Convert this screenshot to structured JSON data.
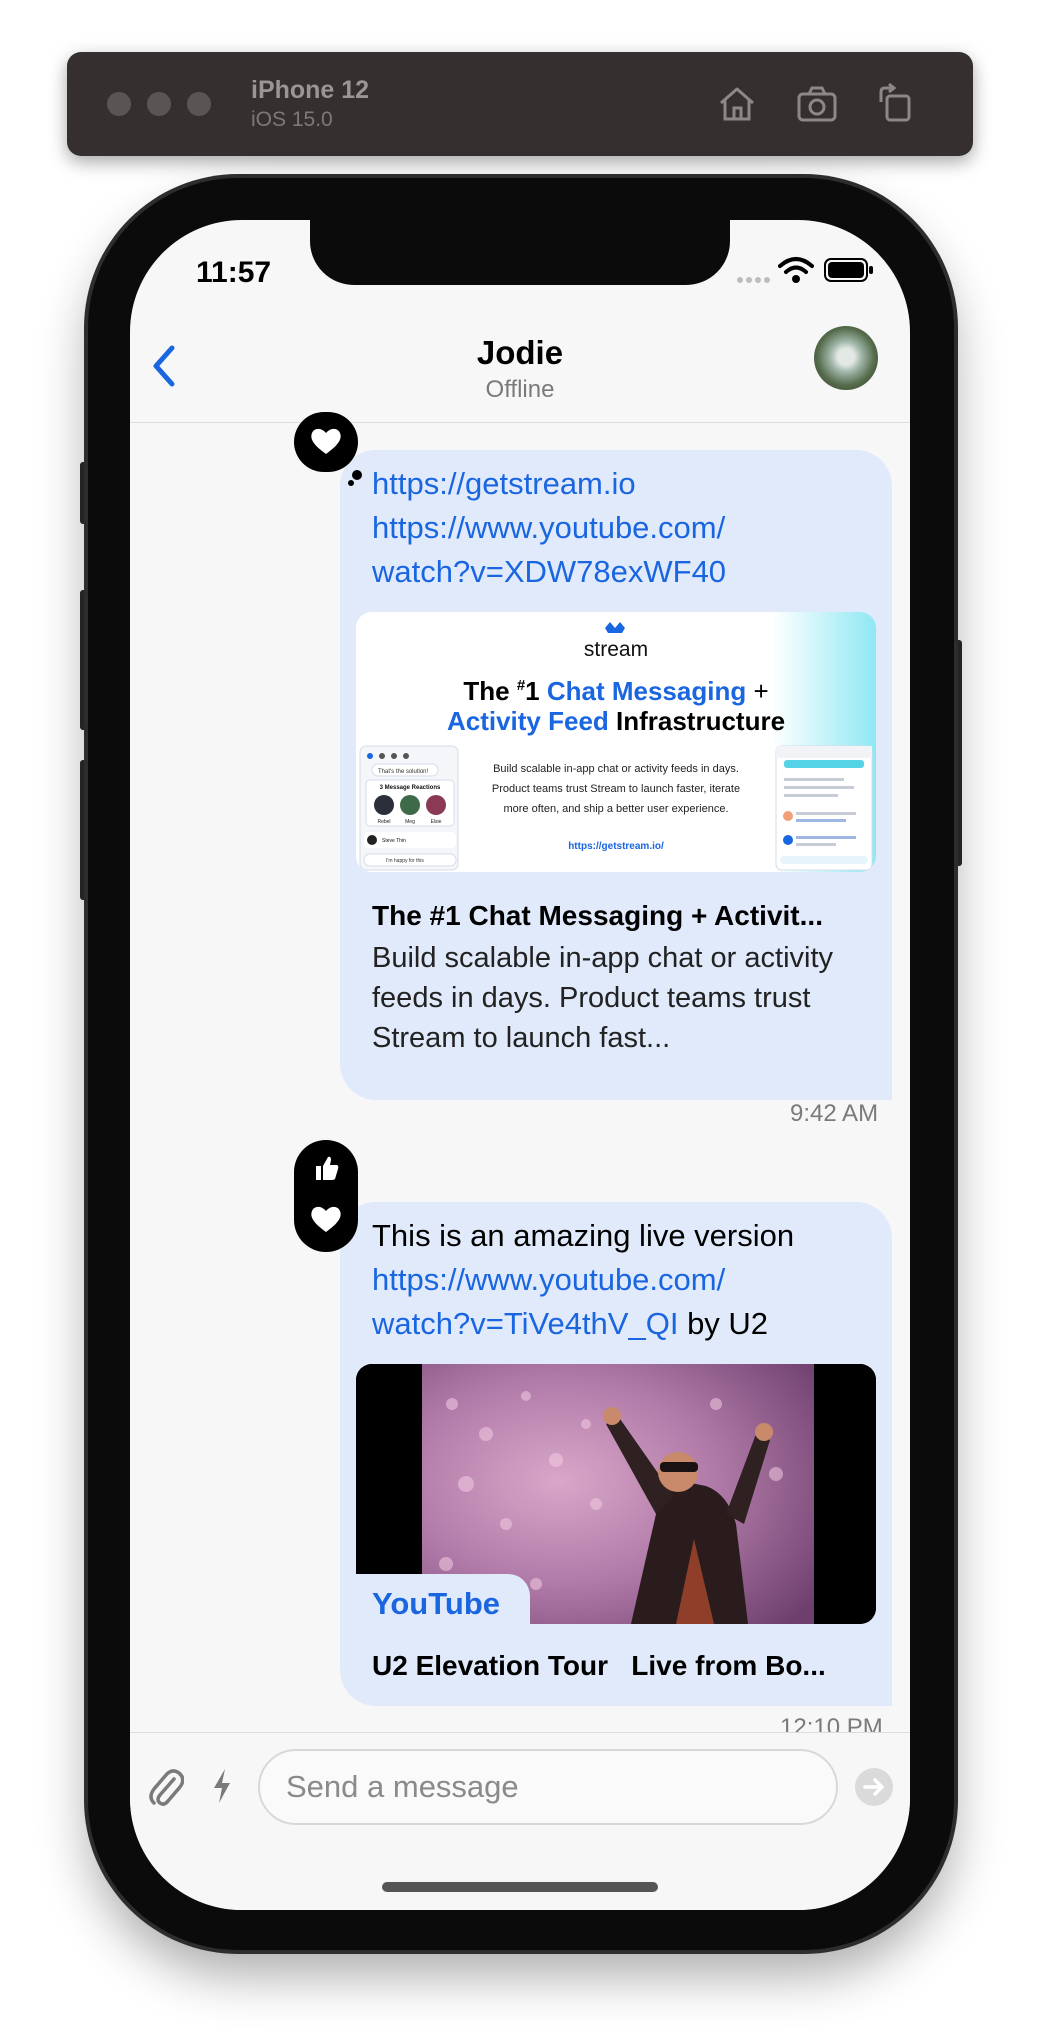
{
  "simulator": {
    "device_name": "iPhone 12",
    "os_version": "iOS 15.0",
    "icons": [
      "home-icon",
      "screenshot-icon",
      "rotate-icon"
    ]
  },
  "status_bar": {
    "time": "11:57"
  },
  "header": {
    "title": "Jodie",
    "subtitle": "Offline",
    "back_icon": "chevron-left-icon"
  },
  "messages": [
    {
      "links": [
        "https://getstream.io",
        "https://www.youtube.com/",
        "watch?v=XDW78exWF40"
      ],
      "reactions": [
        "heart-icon"
      ],
      "preview": {
        "image": {
          "brand": "stream",
          "headline_1_a": "The ",
          "headline_1_sup": "#",
          "headline_1_b": "1 ",
          "headline_1_blue": "Chat Messaging",
          "headline_1_end": " +",
          "headline_2_blue": "Activity Feed",
          "headline_2_end": " Infrastructure",
          "body_1": "Build scalable in-app chat or activity feeds in days.",
          "body_2": "Product teams trust Stream to launch faster, iterate",
          "body_3": "more often, and ship a better user experience.",
          "url": "https://getstream.io/",
          "mock_left_1": "That's the solution!",
          "mock_left_2": "3 Message Reactions",
          "mock_left_names": [
            "Rebel",
            "Meg",
            "Elsie"
          ],
          "mock_left_3": "Steve Thin",
          "mock_left_4": "I'm happy for this"
        },
        "title": "The #1 Chat Messaging + Activit...",
        "description": "Build scalable in-app chat or activity feeds in days. Product teams trust Stream to launch fast..."
      },
      "timestamp": "9:42 AM"
    },
    {
      "text_before": "This is an amazing live version",
      "links": [
        "https://www.youtube.com/",
        "watch?v=TiVe4thV_QI"
      ],
      "text_after": " by U2",
      "reactions": [
        "thumbs-up-icon",
        "heart-icon"
      ],
      "preview": {
        "source": "YouTube",
        "title": "U2 Elevation Tour   Live from Bo..."
      },
      "timestamp": "12:10 PM"
    }
  ],
  "composer": {
    "placeholder": "Send a message",
    "attach_icon": "paperclip-icon",
    "commands_icon": "lightning-icon",
    "send_icon": "send-arrow-icon"
  }
}
